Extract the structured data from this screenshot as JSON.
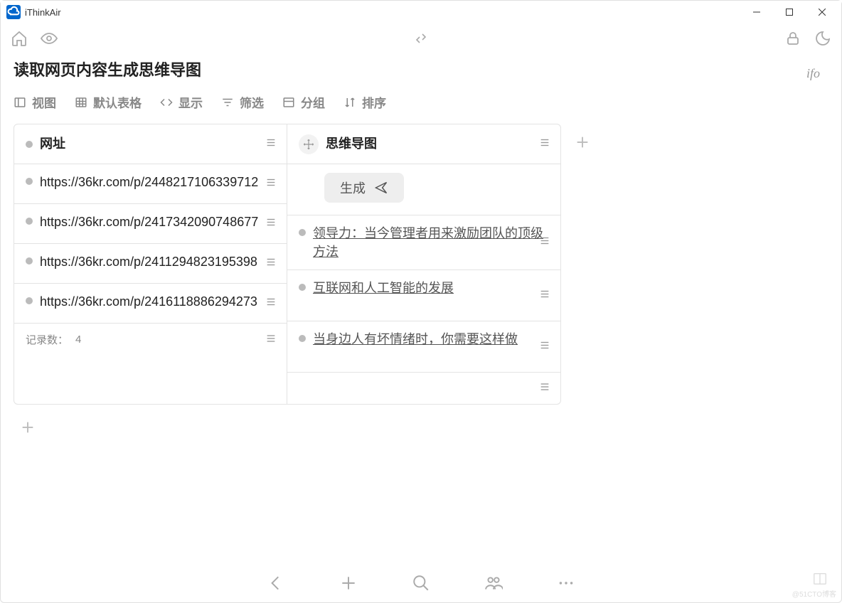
{
  "app": {
    "title": "iThinkAir"
  },
  "info_tag": "ifo",
  "page": {
    "title": "读取网页内容生成思维导图"
  },
  "tabs": {
    "view": "视图",
    "default_table": "默认表格",
    "display": "显示",
    "filter": "筛选",
    "group": "分组",
    "sort": "排序"
  },
  "columns": {
    "url": {
      "header": "网址"
    },
    "mindmap": {
      "header": "思维导图",
      "generate_label": "生成"
    }
  },
  "rows": [
    {
      "url": "https://36kr.com/p/2448217106339712",
      "mindmap": null
    },
    {
      "url": "https://36kr.com/p/2417342090748677",
      "mindmap": "领导力：当今管理者用来激励团队的顶级方法"
    },
    {
      "url": "https://36kr.com/p/2411294823195398",
      "mindmap": "互联网和人工智能的发展"
    },
    {
      "url": "https://36kr.com/p/2416118886294273",
      "mindmap": "当身边人有坏情绪时，你需要这样做"
    }
  ],
  "footer": {
    "record_label": "记录数：",
    "record_count": "4"
  },
  "watermark": "@51CTO博客"
}
